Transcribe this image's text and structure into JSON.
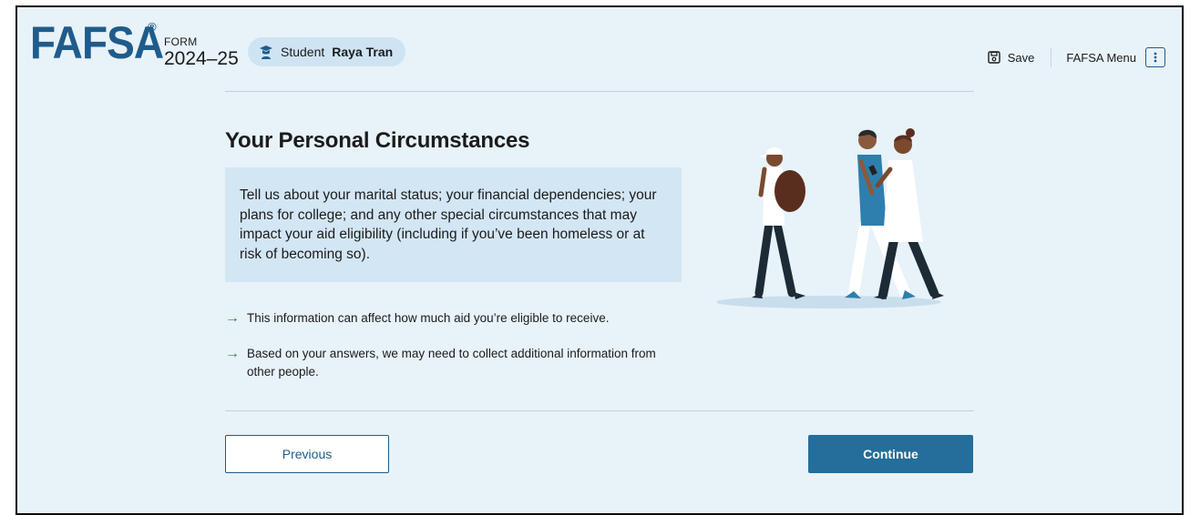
{
  "header": {
    "logo_text": "FAFSA",
    "logo_reg": "®",
    "form_label": "FORM",
    "form_year": "2024–25",
    "student_prefix": "Student",
    "student_name": "Raya Tran",
    "save_label": "Save",
    "menu_label": "FAFSA Menu",
    "menu_icon": "kebab-icon"
  },
  "main": {
    "title": "Your Personal Circumstances",
    "info_text": "Tell us about your marital status; your financial dependencies; your plans for college; and any other special circumstances that may impact your aid eligibility (including if you’ve been homeless or at risk of becoming so).",
    "bullets": [
      "This information can affect how much aid you’re eligible to receive.",
      "Based on your answers, we may need to collect additional information from other people."
    ]
  },
  "footer": {
    "previous_label": "Previous",
    "continue_label": "Continue"
  },
  "colors": {
    "brand": "#1f5c8b",
    "background": "#e8f2f9",
    "info_box": "#d3e6f4",
    "arrow": "#2e8540",
    "continue_bg": "#236e9a"
  }
}
